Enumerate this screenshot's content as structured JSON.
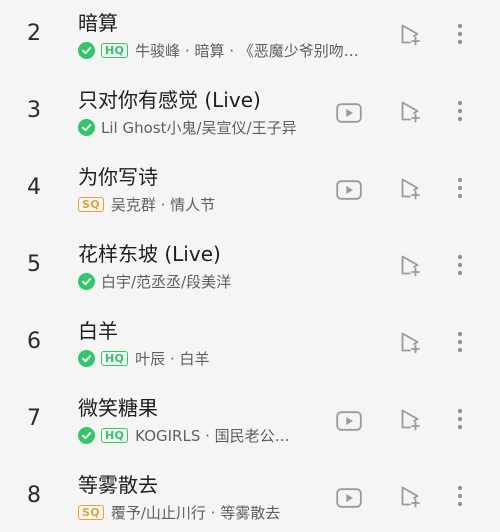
{
  "songs": [
    {
      "rank": "2",
      "title": "暗算",
      "badge": "HQ",
      "verified": true,
      "artist": "牛骏峰 · 暗算 · 《恶魔少爷别吻…",
      "video": false
    },
    {
      "rank": "3",
      "title": "只对你有感觉 (Live)",
      "badge": "",
      "verified": true,
      "artist": "Lil Ghost小鬼/吴宣仪/王子异",
      "video": true
    },
    {
      "rank": "4",
      "title": "为你写诗",
      "badge": "SQ",
      "verified": false,
      "artist": "吴克群 · 情人节",
      "video": true
    },
    {
      "rank": "5",
      "title": "花样东坡 (Live)",
      "badge": "",
      "verified": true,
      "artist": "白宇/范丞丞/段美洋",
      "video": false
    },
    {
      "rank": "6",
      "title": "白羊",
      "badge": "HQ",
      "verified": true,
      "artist": "叶辰 · 白羊",
      "video": false
    },
    {
      "rank": "7",
      "title": "微笑糖果",
      "badge": "HQ",
      "verified": true,
      "artist": "KOGIRLS · 国民老公…",
      "video": true
    },
    {
      "rank": "8",
      "title": "等雾散去",
      "badge": "SQ",
      "verified": false,
      "artist": "覆予/山止川行 · 等雾散去",
      "video": true
    }
  ],
  "icons": {
    "verified": "check-circle-icon",
    "video": "mv-play-icon",
    "add_to_queue": "add-to-playlist-icon",
    "more": "more-vertical-icon"
  },
  "colors": {
    "verified_green": "#34c46a",
    "sq_gold": "#e0a23a"
  }
}
